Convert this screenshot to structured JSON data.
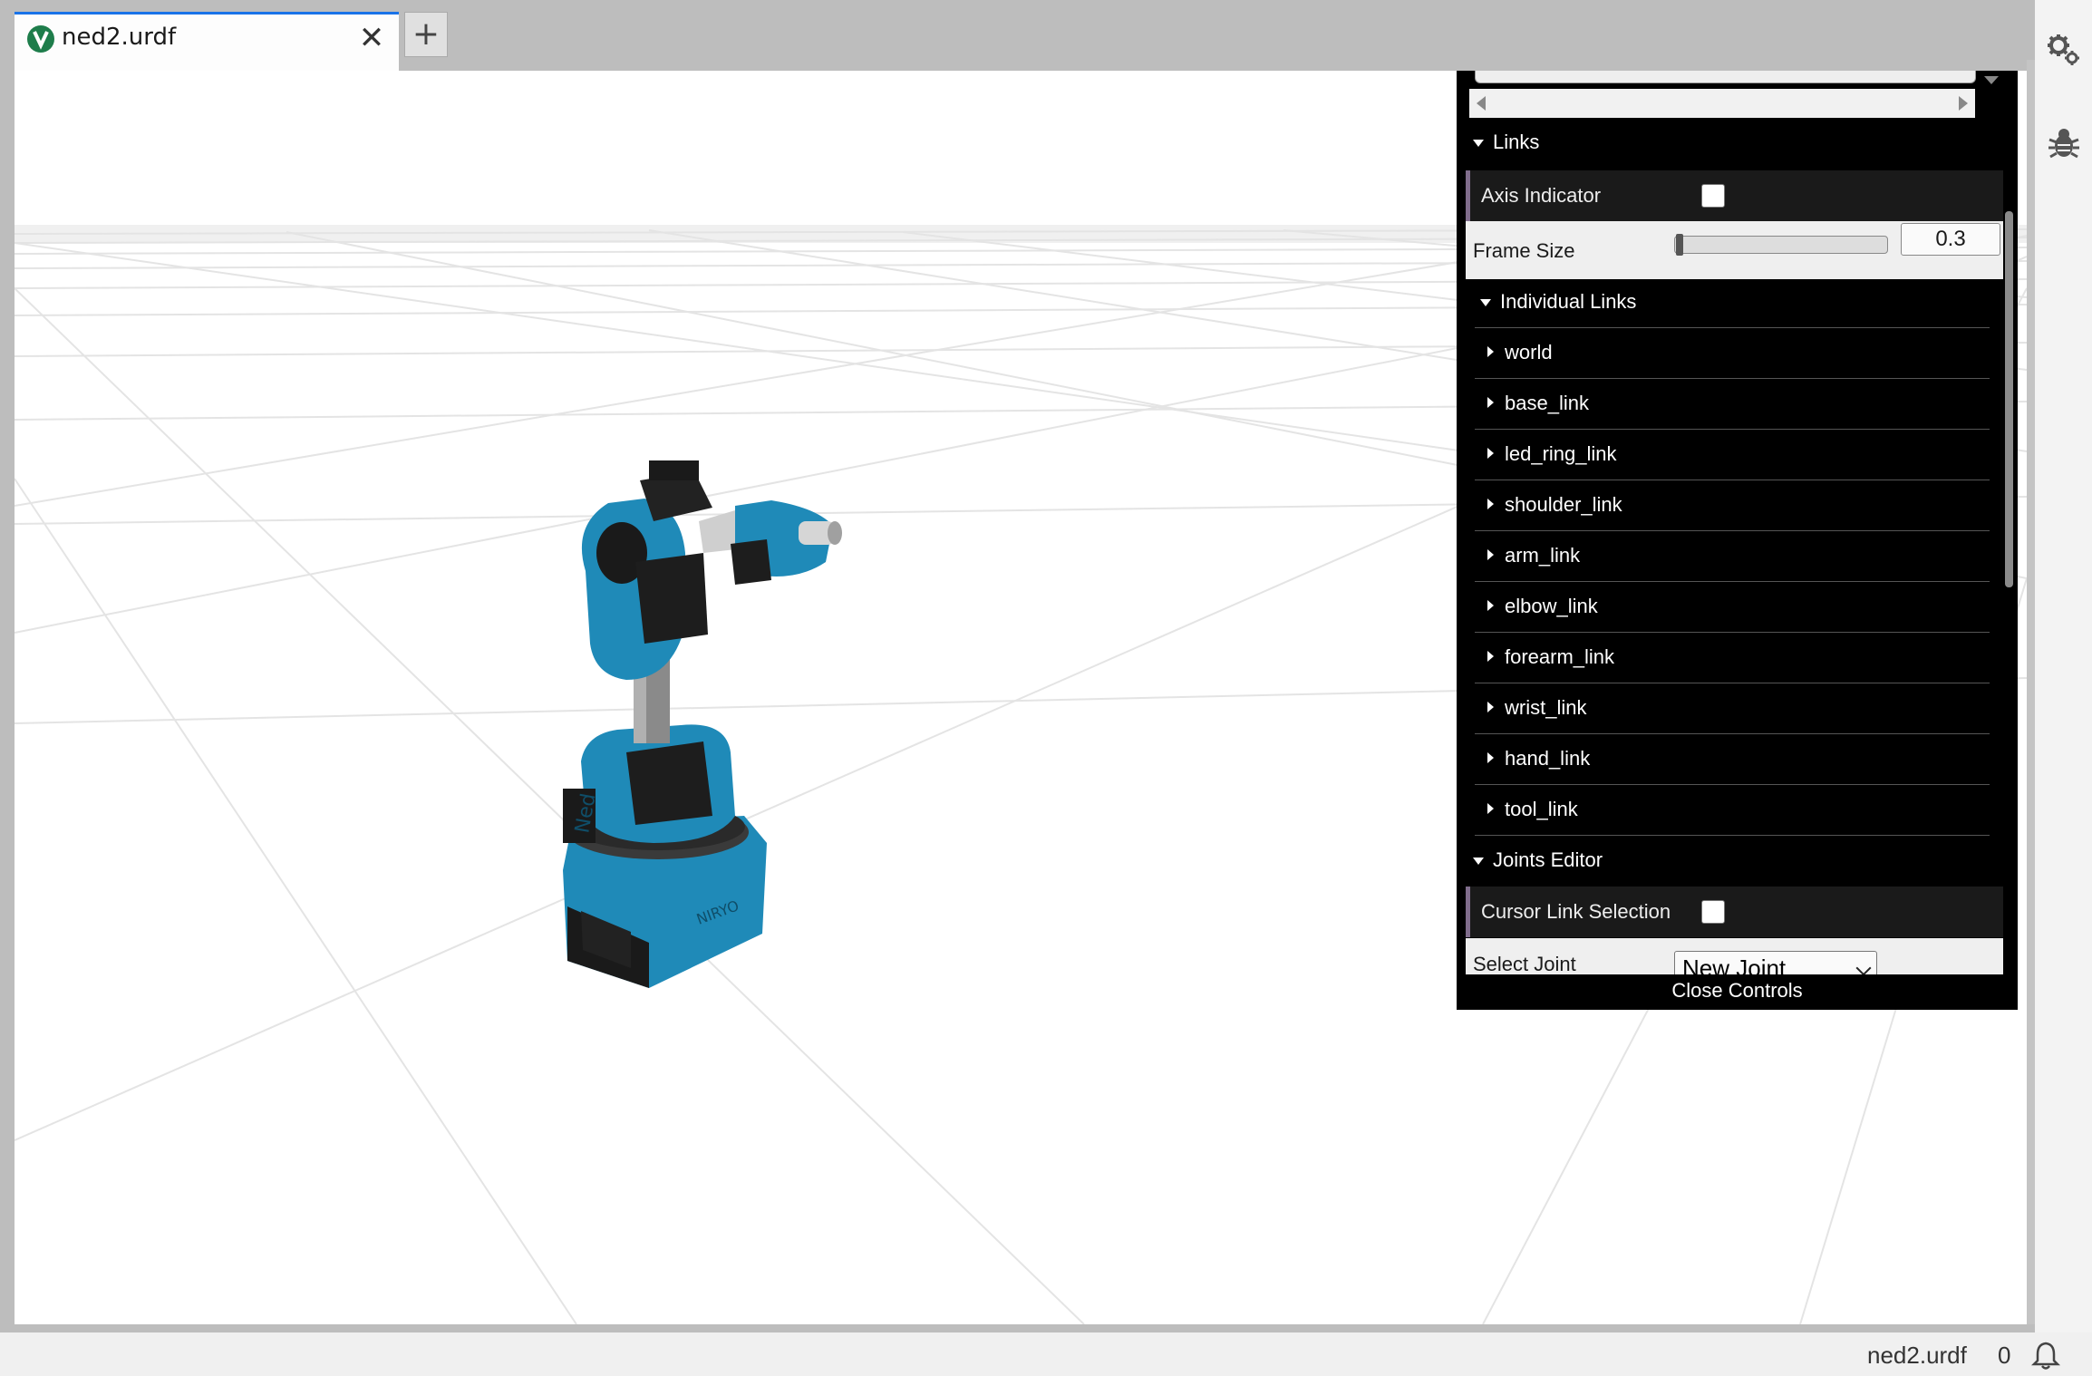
{
  "tab": {
    "title": "ned2.urdf",
    "close_symbol": "✕",
    "new_tab_symbol": "+"
  },
  "sidebar": {
    "icons": [
      "settings-gears-icon",
      "debug-bug-icon"
    ]
  },
  "robot": {
    "brand_text": "NIRYO",
    "model_text": "Ned"
  },
  "panel": {
    "links_folder": "Links",
    "axis_indicator_label": "Axis Indicator",
    "axis_indicator_checked": false,
    "frame_size_label": "Frame Size",
    "frame_size_value": "0.3",
    "individual_links_folder": "Individual Links",
    "links": [
      "world",
      "base_link",
      "led_ring_link",
      "shoulder_link",
      "arm_link",
      "elbow_link",
      "forearm_link",
      "wrist_link",
      "hand_link",
      "tool_link"
    ],
    "joints_editor_folder": "Joints Editor",
    "cursor_link_selection_label": "Cursor Link Selection",
    "cursor_link_selection_checked": false,
    "select_joint_label": "Select Joint",
    "select_joint_value": "New Joint",
    "close_controls": "Close Controls"
  },
  "statusbar": {
    "file": "ned2.urdf",
    "notifications": "0"
  },
  "colors": {
    "robot_blue": "#1e88b4",
    "robot_dark": "#1c1c1c",
    "panel_bg": "#000000",
    "accent": "#1a73e8"
  }
}
